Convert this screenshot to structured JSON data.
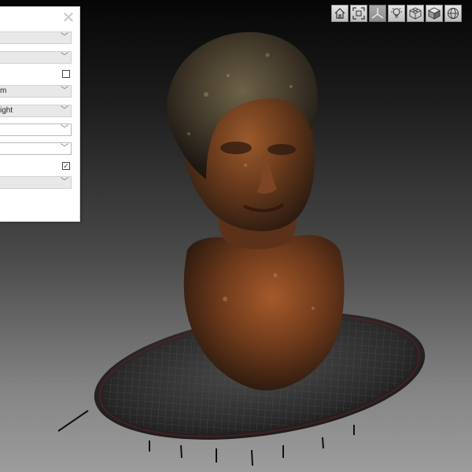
{
  "panel": {
    "close_glyph": "✕",
    "rows": [
      {
        "kind": "dropdown",
        "value": ""
      },
      {
        "kind": "dropdown",
        "value": ""
      },
      {
        "kind": "checkbox",
        "checked": false
      },
      {
        "kind": "dropdown",
        "value": "m"
      },
      {
        "kind": "dropdown",
        "value": "ight"
      },
      {
        "kind": "dropdown-white",
        "value": ""
      },
      {
        "kind": "dropdown-white",
        "value": ""
      },
      {
        "kind": "checkbox",
        "checked": true
      },
      {
        "kind": "dropdown",
        "value": ""
      }
    ],
    "chevron_glyph": "﹀",
    "check_glyph": "✓"
  },
  "toolbar": {
    "buttons": [
      {
        "icon": "home-icon",
        "active": false
      },
      {
        "icon": "fit-view-icon",
        "active": false
      },
      {
        "icon": "axes-icon",
        "active": true
      },
      {
        "icon": "lightbulb-icon",
        "active": false
      },
      {
        "icon": "wireframe-cube-icon",
        "active": false
      },
      {
        "icon": "solid-cube-icon",
        "active": false
      },
      {
        "icon": "sphere-grid-icon",
        "active": false
      }
    ]
  },
  "colors": {
    "accent_active": "#8c8c8c",
    "model_bronze": "#8a4a22",
    "base_dark": "#2a2a2a"
  }
}
